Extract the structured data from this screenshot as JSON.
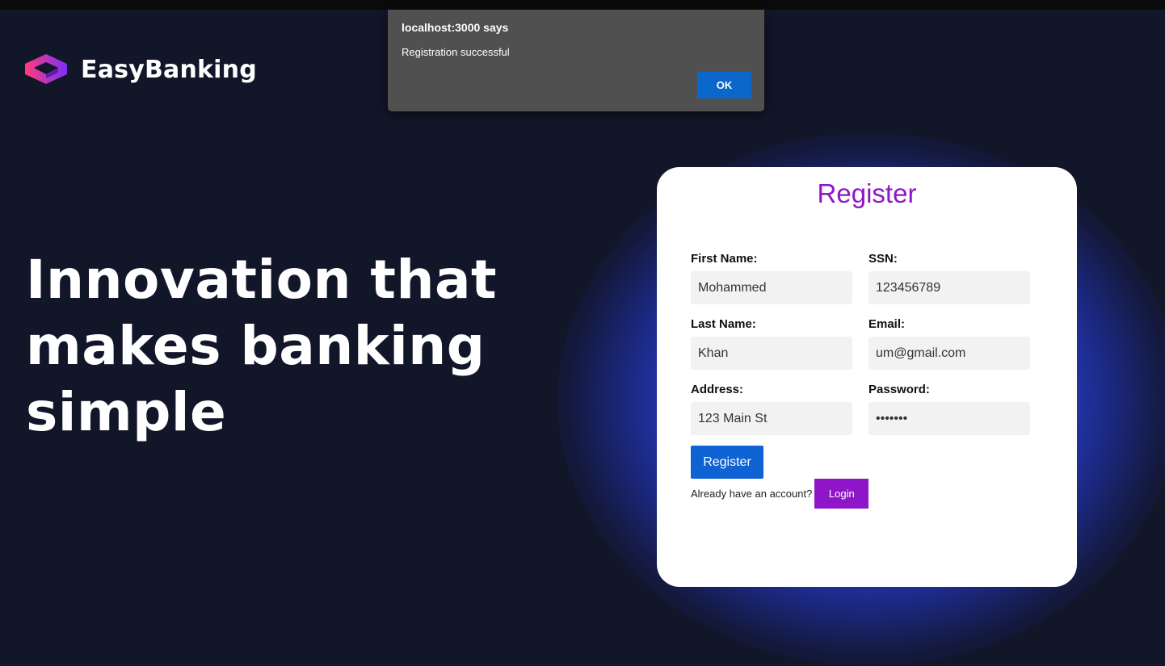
{
  "brand": {
    "name": "EasyBanking",
    "logo_icon": "isometric-cube-logo-icon",
    "logo_colors": [
      "#7b2ff7",
      "#ff3c7a"
    ]
  },
  "hero": {
    "line1": "Innovation that",
    "line2": "makes banking",
    "line3": "simple"
  },
  "register_form": {
    "title": "Register",
    "fields": {
      "first_name": {
        "label": "First Name:",
        "value": "Mohammed"
      },
      "ssn": {
        "label": "SSN:",
        "value": "123456789"
      },
      "last_name": {
        "label": "Last Name:",
        "value": "Khan"
      },
      "email": {
        "label": "Email:",
        "value": "um@gmail.com"
      },
      "address": {
        "label": "Address:",
        "value": "123 Main St"
      },
      "password": {
        "label": "Password:",
        "value": "•••••••"
      }
    },
    "register_button": "Register",
    "login_prompt": "Already have an account?",
    "login_button": "Login"
  },
  "dialog": {
    "title": "localhost:3000 says",
    "message": "Registration successful",
    "ok_button": "OK"
  },
  "colors": {
    "page_background": "#121629",
    "accent_purple": "#8e16c8",
    "button_blue": "#0f62d3",
    "glow_blue": "#3c5aff",
    "dialog_background": "#505050"
  }
}
